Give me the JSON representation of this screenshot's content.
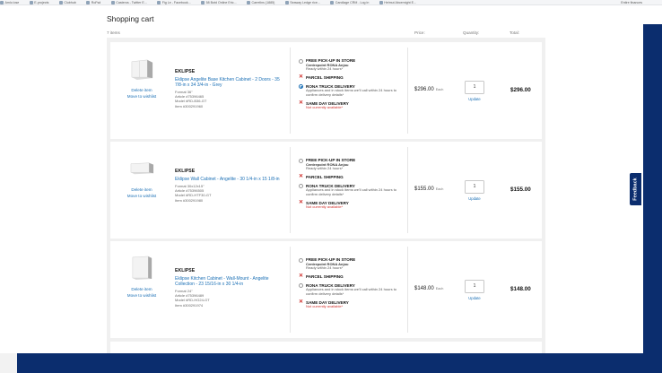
{
  "bookmarks": [
    "Amlo lose",
    "E-projects",
    "Clubhub",
    "RoFsd",
    "Casteros - Twitter E...",
    "Fig Le - Facebook...",
    "58 Botd Online Eric...",
    "Carrelins (1885)",
    "Seaway Ledge rice...",
    "Candlage CRM - Log in",
    "Helmut Abcernight E..."
  ],
  "bookmarks_right": "Entire finances",
  "page": {
    "title": "Shopping cart",
    "items_count": "7 items",
    "col_price": "Price:",
    "col_qty": "Quantity:",
    "col_total": "Total:"
  },
  "feedback_label": "Feedback",
  "cart_items": [
    {
      "brand": "EKLIPSE",
      "name": "Eklipse Angelite Base Kitchen Cabinet - 2 Doors - 35 7/8-in x 34 3/4-in - Grey",
      "format": "Format 36\"",
      "article": "Article #75396465",
      "model": "Model #RD-B36-GT",
      "item": "Item #300291960",
      "delete": "Delete item",
      "wishlist": "Move to wishlist",
      "pickup_title": "FREE PICK-UP IN STORE",
      "pickup_store": "Centrepoint RONA Anjou",
      "pickup_ready": "Ready within 24 hours*",
      "parcel_title": "PARCEL SHIPPING",
      "truck_title": "RONA TRUCK DELIVERY",
      "truck_sub": "Appliances and in stock items we'll call within 24 hours to confirm delivery details*",
      "sameday_title": "SAME DAY DELIVERY",
      "sameday_sub": "Not currently available*",
      "price": "$296.00",
      "each": "Each",
      "qty": "1",
      "update": "Update",
      "total": "$296.00"
    },
    {
      "brand": "EKLIPSE",
      "name": "Eklipse Wall Cabinet - Angelite - 30 1/4-in x 15 1/8-in",
      "format": "Format 30x12x15\"",
      "article": "Article #75396505",
      "model": "Model #RD-HTF30-GT",
      "item": "Item #300291980",
      "delete": "Delete item",
      "wishlist": "Move to wishlist",
      "pickup_title": "FREE PICK-UP IN STORE",
      "pickup_store": "Centrepoint RONA Anjou",
      "pickup_ready": "Ready within 24 hours*",
      "parcel_title": "PARCEL SHIPPING",
      "truck_title": "RONA TRUCK DELIVERY",
      "truck_sub": "Appliances and in stock items we'll call within 24 hours to confirm delivery details*",
      "sameday_title": "SAME DAY DELIVERY",
      "sameday_sub": "Not currently available*",
      "price": "$155.00",
      "each": "Each",
      "qty": "1",
      "update": "Update",
      "total": "$155.00"
    },
    {
      "brand": "EKLIPSE",
      "name": "Eklipse Kitchen Cabinet - Wall-Mount - Angelite Collection - 23 15/16-in x 30 1/4-in",
      "format": "Format 24\"",
      "article": "Article #75396489",
      "model": "Model #RD-HG24-GT",
      "item": "Item #300291974",
      "delete": "Delete item",
      "wishlist": "Move to wishlist",
      "pickup_title": "FREE PICK-UP IN STORE",
      "pickup_store": "Centrepoint RONA Anjou",
      "pickup_ready": "Ready within 24 hours*",
      "parcel_title": "PARCEL SHIPPING",
      "truck_title": "RONA TRUCK DELIVERY",
      "truck_sub": "Appliances and in stock items we'll call within 24 hours to confirm delivery details*",
      "sameday_title": "SAME DAY DELIVERY",
      "sameday_sub": "Not currently available*",
      "price": "$148.00",
      "each": "Each",
      "qty": "1",
      "update": "Update",
      "total": "$148.00"
    }
  ],
  "colors": {
    "link": "#1a6fb5",
    "error": "#d0312d",
    "frame": "#0b2d6e"
  }
}
